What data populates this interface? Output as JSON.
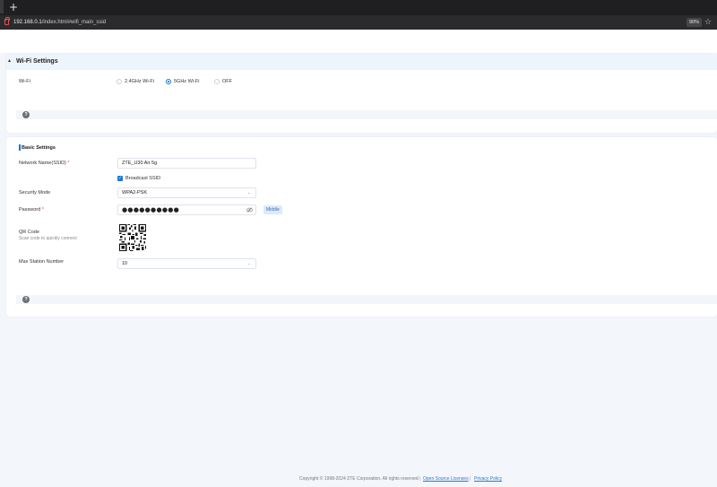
{
  "browser": {
    "new_tab_label": "+",
    "url_host": "192.168.0.1",
    "url_path": "/index.html#wifi_main_ssid",
    "zoom": "90%"
  },
  "wifi_settings": {
    "title": "Wi-Fi Settings",
    "wifi_label": "Wi-Fi",
    "options": [
      {
        "label": "2.4GHz Wi-Fi",
        "selected": false
      },
      {
        "label": "5GHz Wi-Fi",
        "selected": true
      },
      {
        "label": "OFF",
        "selected": false
      }
    ],
    "help_label": "?"
  },
  "basic_settings": {
    "title": "Basic Settings",
    "network_name_label": "Network Name(SSID)",
    "required_mark": "*",
    "network_name_value": "ZTE_U30 Air 5g",
    "broadcast_ssid_label": "Broadcast SSID",
    "broadcast_ssid_checked": true,
    "security_mode_label": "Security Mode",
    "security_mode_value": "WPA2-PSK",
    "password_label": "Password",
    "password_mask": "●●●●●●●●●●",
    "password_strength": "Middle",
    "qr_label": "QR Code",
    "qr_hint": "Scan code to quickly connect",
    "max_station_label": "Max Station Number",
    "max_station_value": "10",
    "help_label": "?"
  },
  "footer": {
    "copyright": "Copyright © 1998-2024 ZTE Corporation. All rights reserved",
    "separator": "|",
    "open_source": "Open Source Licenses",
    "privacy": "Privacy Policy"
  },
  "colors": {
    "accent": "#1a78d6",
    "required": "#e23b3b",
    "page_background": "#f3f6fb"
  }
}
